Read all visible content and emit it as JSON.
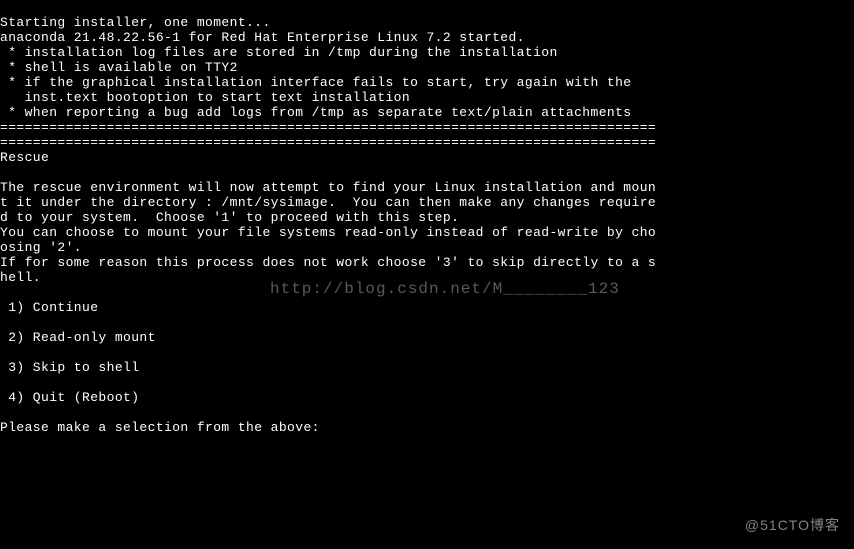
{
  "terminal": {
    "lines": {
      "l0": "Starting installer, one moment...",
      "l1": "anaconda 21.48.22.56-1 for Red Hat Enterprise Linux 7.2 started.",
      "l2": " * installation log files are stored in /tmp during the installation",
      "l3": " * shell is available on TTY2",
      "l4": " * if the graphical installation interface fails to start, try again with the",
      "l5": "   inst.text bootoption to start text installation",
      "l6": " * when reporting a bug add logs from /tmp as separate text/plain attachments",
      "l7": "================================================================================",
      "l8": "================================================================================",
      "l9": "Rescue",
      "l10": "",
      "l11": "The rescue environment will now attempt to find your Linux installation and moun",
      "l12": "t it under the directory : /mnt/sysimage.  You can then make any changes require",
      "l13": "d to your system.  Choose '1' to proceed with this step.",
      "l14": "You can choose to mount your file systems read-only instead of read-write by cho",
      "l15": "osing '2'.",
      "l16": "If for some reason this process does not work choose '3' to skip directly to a s",
      "l17": "hell.",
      "l18": "",
      "l19": " 1) Continue",
      "l20": "",
      "l21": " 2) Read-only mount",
      "l22": "",
      "l23": " 3) Skip to shell",
      "l24": "",
      "l25": " 4) Quit (Reboot)",
      "l26": "",
      "l27": "Please make a selection from the above: "
    }
  },
  "watermarks": {
    "center": "http://blog.csdn.net/M________123",
    "corner": "@51CTO博客"
  }
}
